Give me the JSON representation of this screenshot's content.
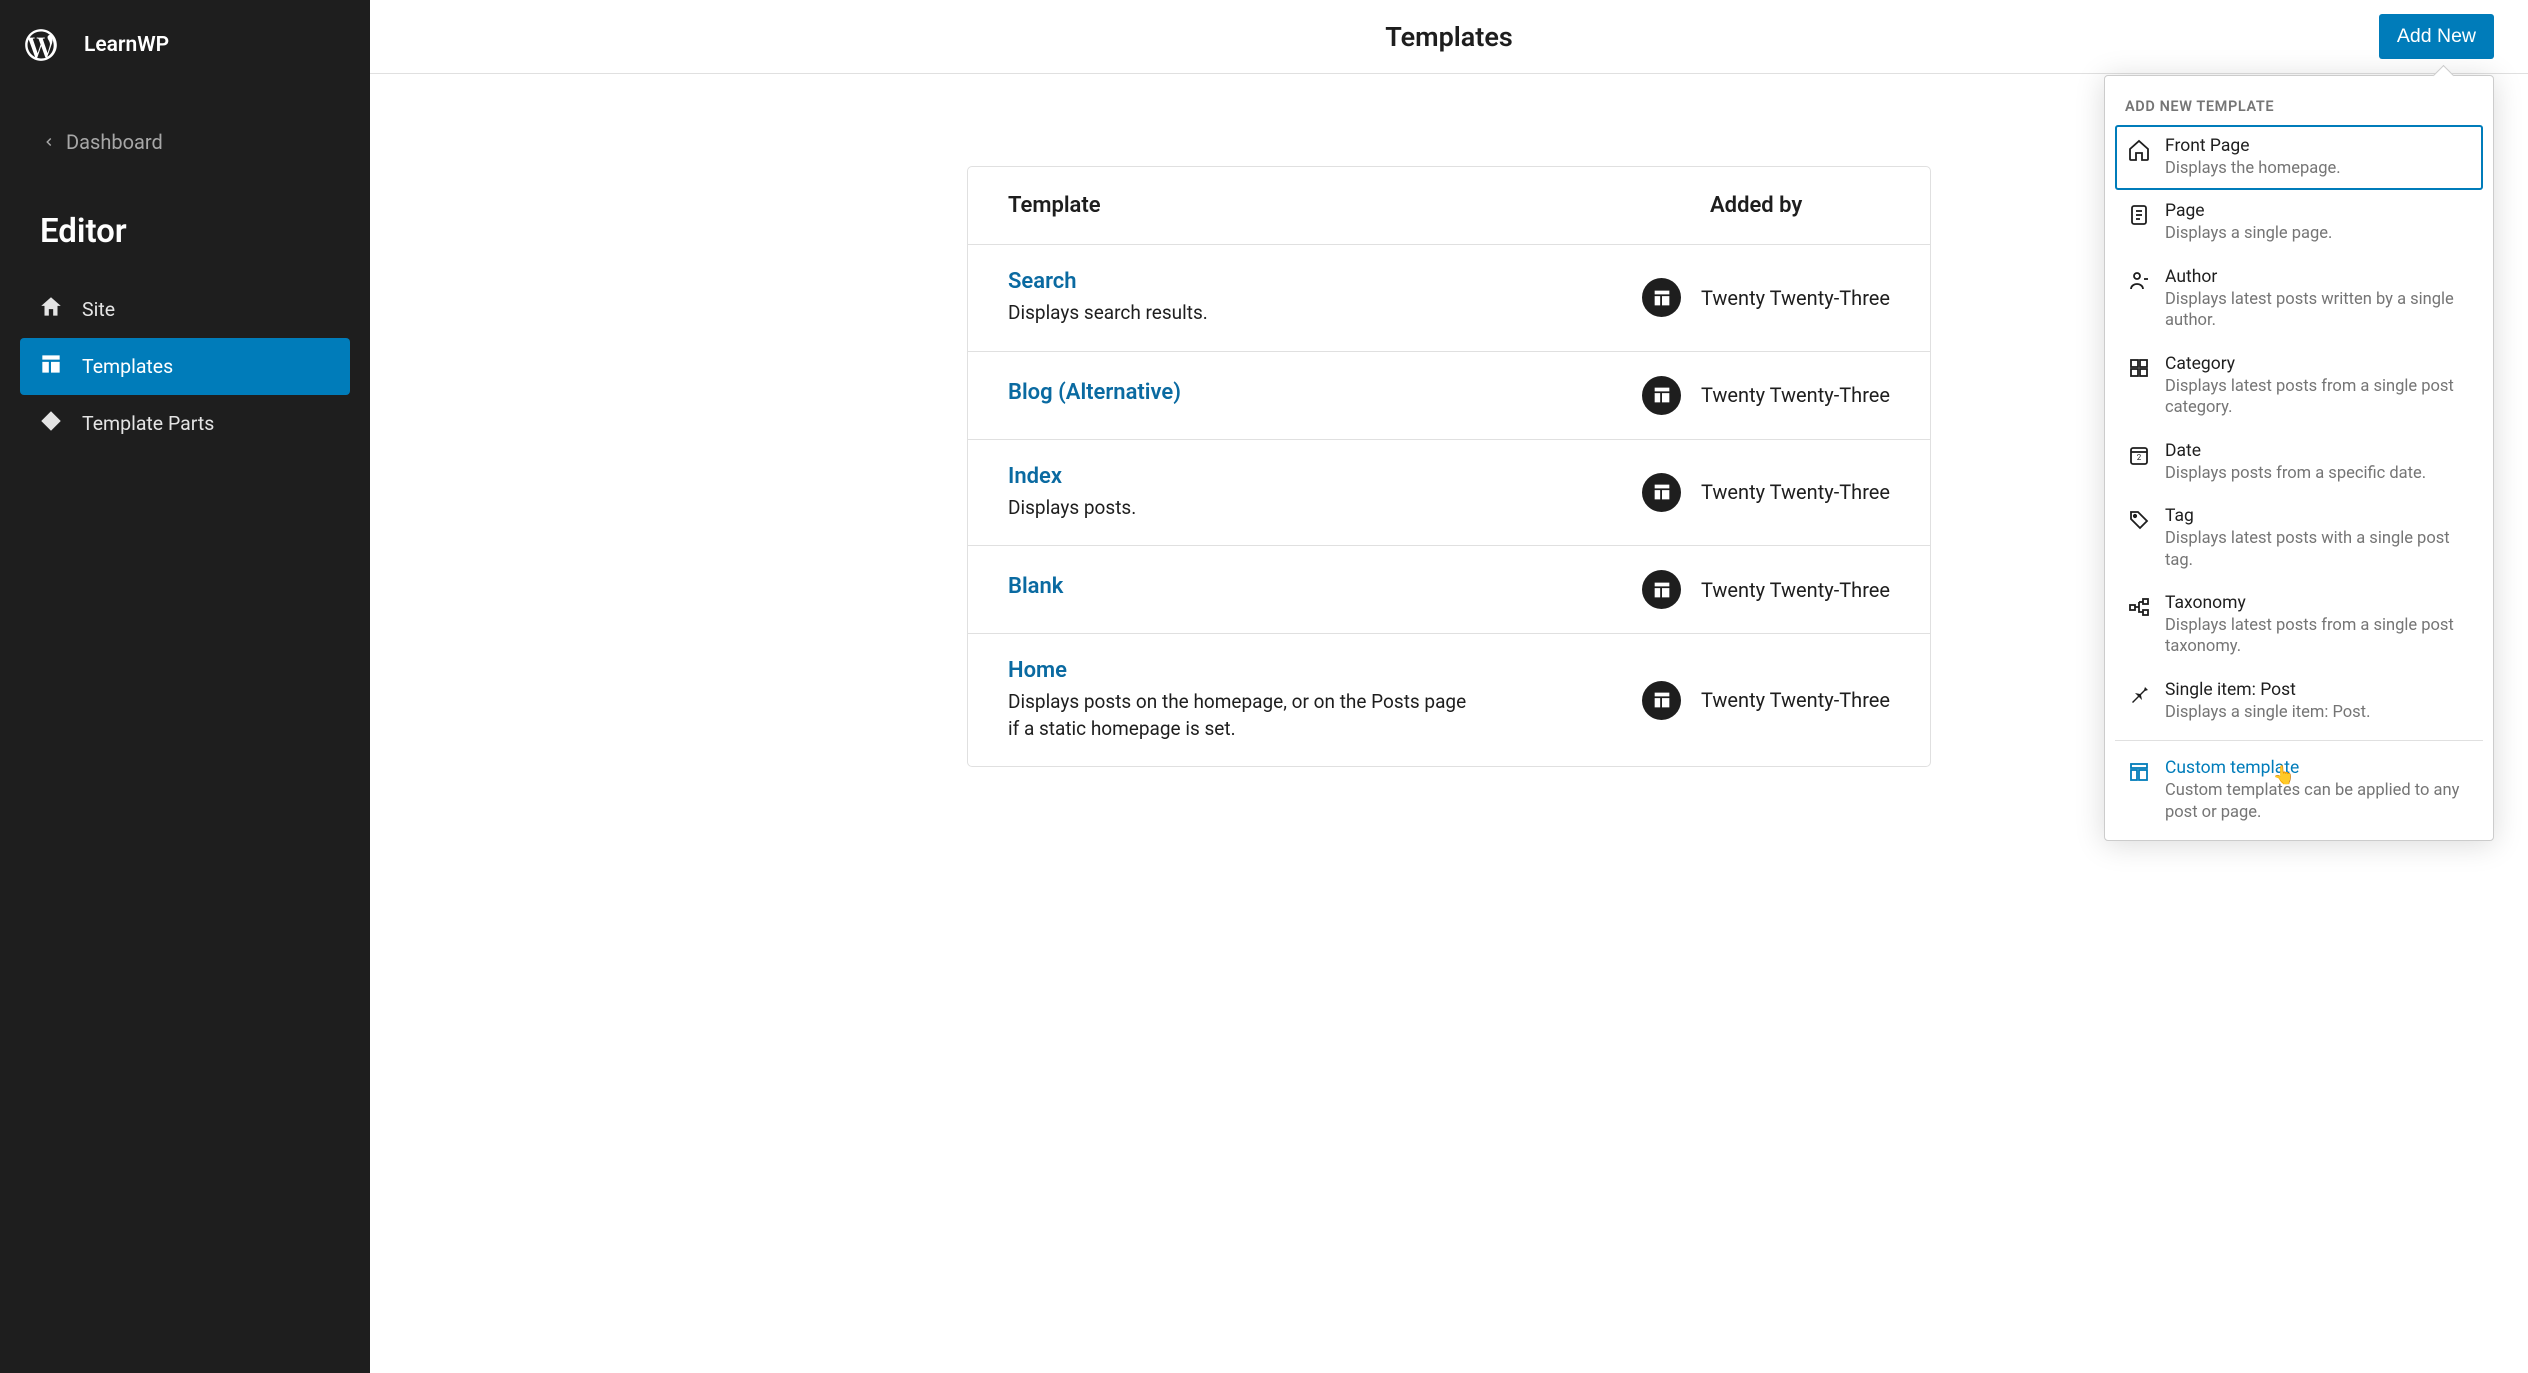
{
  "site_name": "LearnWP",
  "back_label": "Dashboard",
  "section_title": "Editor",
  "nav": [
    {
      "label": "Site"
    },
    {
      "label": "Templates"
    },
    {
      "label": "Template Parts"
    }
  ],
  "page_title": "Templates",
  "add_new_label": "Add New",
  "table": {
    "col_template": "Template",
    "col_added": "Added by",
    "rows": [
      {
        "title": "Search",
        "desc": "Displays search results.",
        "added": "Twenty Twenty-Three"
      },
      {
        "title": "Blog (Alternative)",
        "desc": "",
        "added": "Twenty Twenty-Three"
      },
      {
        "title": "Index",
        "desc": "Displays posts.",
        "added": "Twenty Twenty-Three"
      },
      {
        "title": "Blank",
        "desc": "",
        "added": "Twenty Twenty-Three"
      },
      {
        "title": "Home",
        "desc": "Displays posts on the homepage, or on the Posts page if a static homepage is set.",
        "added": "Twenty Twenty-Three"
      }
    ]
  },
  "popover": {
    "heading": "ADD NEW TEMPLATE",
    "items": [
      {
        "title": "Front Page",
        "desc": "Displays the homepage."
      },
      {
        "title": "Page",
        "desc": "Displays a single page."
      },
      {
        "title": "Author",
        "desc": "Displays latest posts written by a single author."
      },
      {
        "title": "Category",
        "desc": "Displays latest posts from a single post category."
      },
      {
        "title": "Date",
        "desc": "Displays posts from a specific date."
      },
      {
        "title": "Tag",
        "desc": "Displays latest posts with a single post tag."
      },
      {
        "title": "Taxonomy",
        "desc": "Displays latest posts from a single post taxonomy."
      },
      {
        "title": "Single item: Post",
        "desc": "Displays a single item: Post."
      }
    ],
    "custom": {
      "title": "Custom template",
      "desc": "Custom templates can be applied to any post or page."
    }
  }
}
